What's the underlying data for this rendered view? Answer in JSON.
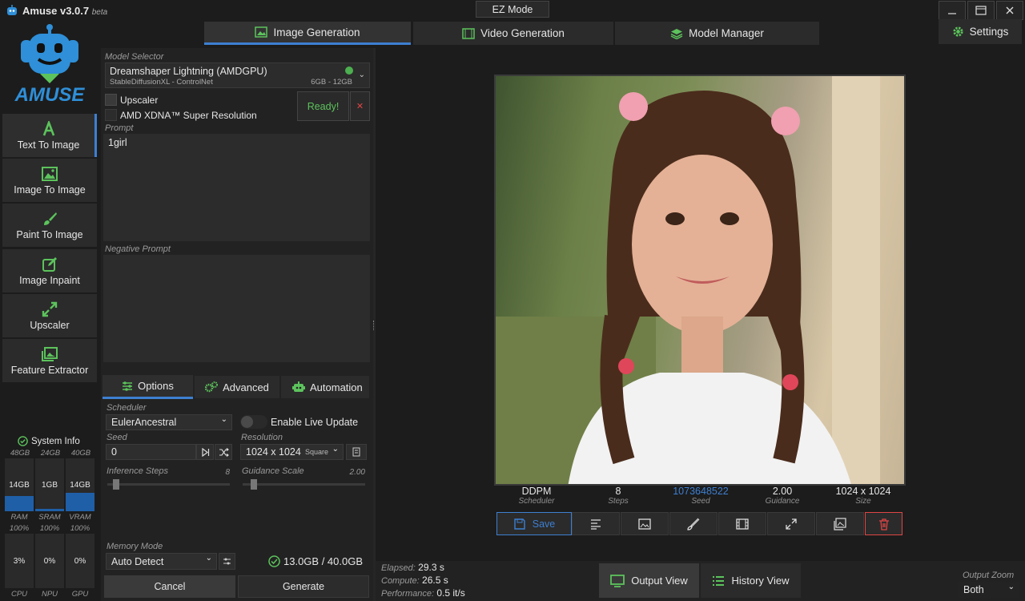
{
  "app": {
    "title": "Amuse v3.0.7",
    "beta": "beta",
    "logo_text": "AMUSE",
    "ez_mode": "EZ Mode"
  },
  "tabs": [
    {
      "label": "Image Generation",
      "icon": "image-icon",
      "active": true
    },
    {
      "label": "Video Generation",
      "icon": "film-icon",
      "active": false
    },
    {
      "label": "Model Manager",
      "icon": "layers-icon",
      "active": false
    }
  ],
  "settings_label": "Settings",
  "sidebar": [
    {
      "label": "Text To Image",
      "icon": "text-icon"
    },
    {
      "label": "Image To Image",
      "icon": "image-icon"
    },
    {
      "label": "Paint To Image",
      "icon": "brush-icon"
    },
    {
      "label": "Image Inpaint",
      "icon": "edit-icon"
    },
    {
      "label": "Upscaler",
      "icon": "expand-icon"
    },
    {
      "label": "Feature Extractor",
      "icon": "images-icon"
    }
  ],
  "system_info": {
    "title": "System Info",
    "totals": [
      "48GB",
      "24GB",
      "40GB"
    ],
    "memory": [
      {
        "value": "14GB",
        "label": "RAM",
        "level": 0.29
      },
      {
        "value": "1GB",
        "label": "SRAM",
        "level": 0.04
      },
      {
        "value": "14GB",
        "label": "VRAM",
        "level": 0.35
      }
    ],
    "max": [
      "100%",
      "100%",
      "100%"
    ],
    "usage": [
      {
        "value": "3%",
        "label": "CPU"
      },
      {
        "value": "0%",
        "label": "NPU"
      },
      {
        "value": "0%",
        "label": "GPU"
      }
    ]
  },
  "model_selector": {
    "label": "Model Selector",
    "name": "Dreamshaper Lightning (AMDGPU)",
    "sub": "StableDiffusionXL - ControlNet",
    "mem": "6GB - 12GB",
    "status_color": "#4caf50"
  },
  "upscaler": {
    "label": "Upscaler",
    "sub": "AMD XDNA™ Super Resolution"
  },
  "ready": {
    "label": "Ready!",
    "close": "✕"
  },
  "prompt": {
    "label": "Prompt",
    "value": "1girl"
  },
  "negative_prompt": {
    "label": "Negative Prompt",
    "value": ""
  },
  "option_tabs": [
    {
      "label": "Options",
      "icon": "sliders-icon"
    },
    {
      "label": "Advanced",
      "icon": "gears-icon"
    },
    {
      "label": "Automation",
      "icon": "robot-icon"
    }
  ],
  "scheduler": {
    "label": "Scheduler",
    "value": "EulerAncestral"
  },
  "live_update": {
    "label": "Enable Live Update"
  },
  "seed": {
    "label": "Seed",
    "value": "0"
  },
  "resolution": {
    "label": "Resolution",
    "value": "1024 x 1024",
    "aspect": "Square"
  },
  "inference_steps": {
    "label": "Inference Steps",
    "value": "8",
    "level": 0.05
  },
  "guidance_scale": {
    "label": "Guidance Scale",
    "value": "2.00",
    "level": 0.07
  },
  "memory_mode": {
    "label": "Memory Mode",
    "value": "Auto Detect"
  },
  "memory_usage": "13.0GB / 40.0GB",
  "buttons": {
    "cancel": "Cancel",
    "generate": "Generate"
  },
  "result": {
    "stats": [
      {
        "value": "DDPM",
        "label": "Scheduler"
      },
      {
        "value": "8",
        "label": "Steps"
      },
      {
        "value": "1073648522",
        "label": "Seed"
      },
      {
        "value": "2.00",
        "label": "Guidance"
      },
      {
        "value": "1024 x 1024",
        "label": "Size"
      }
    ],
    "save": "Save"
  },
  "timing": {
    "elapsed_label": "Elapsed:",
    "elapsed": "29.3 s",
    "compute_label": "Compute:",
    "compute": "26.5 s",
    "perf_label": "Performance:",
    "perf": "0.5 it/s"
  },
  "view_tabs": {
    "output": "Output View",
    "history": "History View"
  },
  "zoom": {
    "label": "Output Zoom",
    "value": "Both"
  },
  "colors": {
    "accent": "#3d7fd1",
    "green": "#5cc35c",
    "red": "#e04545"
  }
}
